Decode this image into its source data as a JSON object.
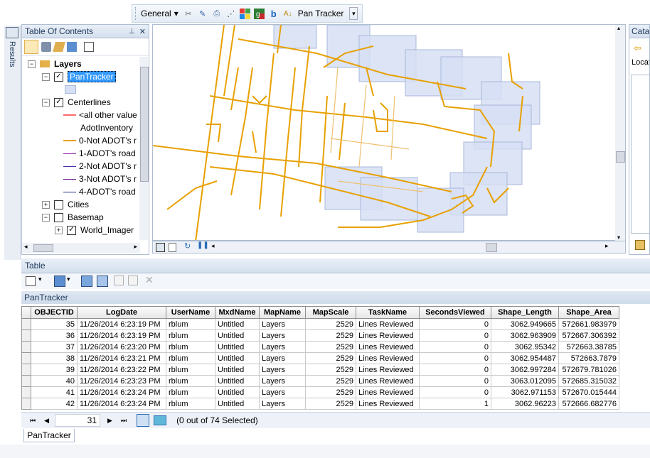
{
  "toolbar": {
    "menu_label": "General",
    "pan_tracker_label": "Pan Tracker"
  },
  "results_strip": {
    "label": "Results"
  },
  "toc": {
    "title": "Table Of Contents",
    "items": [
      {
        "label": "Layers"
      },
      {
        "label": "PanTracker"
      },
      {
        "label": "Centerlines"
      },
      {
        "label": "<all other value"
      },
      {
        "label": "AdotInventory"
      },
      {
        "label": "0-Not ADOT's r"
      },
      {
        "label": "1-ADOT's road"
      },
      {
        "label": "2-Not ADOT's r"
      },
      {
        "label": "3-Not ADOT's r"
      },
      {
        "label": "4-ADOT's road"
      },
      {
        "label": "Cities"
      },
      {
        "label": "Basemap"
      },
      {
        "label": "World_Imager"
      }
    ],
    "colors": {
      "all_other": "#ff6b6b",
      "r0": "#e8a000",
      "r1": "#9b2fae",
      "r2": "#4b2ea6",
      "r3": "#6a1c8c",
      "r4": "#1e2f8c",
      "pantracker_fill": "#d6dff5"
    }
  },
  "catalog": {
    "title": "Cata",
    "location_label": "Locat"
  },
  "table": {
    "title": "Table",
    "layer_name": "PanTracker",
    "columns": [
      "OBJECTID",
      "LogDate",
      "UserName",
      "MxdName",
      "MapName",
      "MapScale",
      "TaskName",
      "SecondsViewed",
      "Shape_Length",
      "Shape_Area"
    ],
    "rows": [
      [
        "35",
        "11/26/2014 6:23:19 PM",
        "rblum",
        "Untitled",
        "Layers",
        "2529",
        "Lines Reviewed",
        "0",
        "3062.949665",
        "572661.983979"
      ],
      [
        "36",
        "11/26/2014 6:23:19 PM",
        "rblum",
        "Untitled",
        "Layers",
        "2529",
        "Lines Reviewed",
        "0",
        "3062.963909",
        "572667.306392"
      ],
      [
        "37",
        "11/26/2014 6:23:20 PM",
        "rblum",
        "Untitled",
        "Layers",
        "2529",
        "Lines Reviewed",
        "0",
        "3062.95342",
        "572663.38785"
      ],
      [
        "38",
        "11/26/2014 6:23:21 PM",
        "rblum",
        "Untitled",
        "Layers",
        "2529",
        "Lines Reviewed",
        "0",
        "3062.954487",
        "572663.7879"
      ],
      [
        "39",
        "11/26/2014 6:23:22 PM",
        "rblum",
        "Untitled",
        "Layers",
        "2529",
        "Lines Reviewed",
        "0",
        "3062.997284",
        "572679.781026"
      ],
      [
        "40",
        "11/26/2014 6:23:23 PM",
        "rblum",
        "Untitled",
        "Layers",
        "2529",
        "Lines Reviewed",
        "0",
        "3063.012095",
        "572685.315032"
      ],
      [
        "41",
        "11/26/2014 6:23:24 PM",
        "rblum",
        "Untitled",
        "Layers",
        "2529",
        "Lines Reviewed",
        "0",
        "3062.971153",
        "572670.015444"
      ],
      [
        "42",
        "11/26/2014 6:23:24 PM",
        "rblum",
        "Untitled",
        "Layers",
        "2529",
        "Lines Reviewed",
        "1",
        "3062.96223",
        "572666.682776"
      ]
    ],
    "current_record": "31",
    "selection_status": "(0 out of 74 Selected)",
    "bottom_tab": "PanTracker"
  }
}
